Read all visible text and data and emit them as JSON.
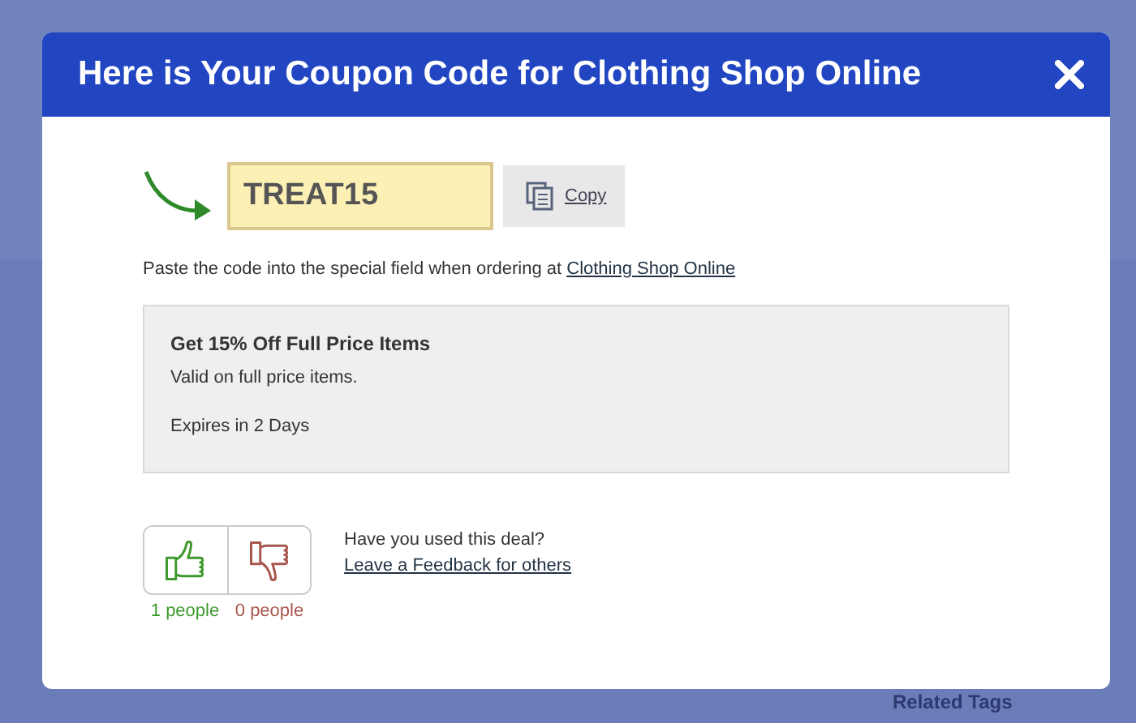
{
  "background": {
    "related_tags_heading": "Related Tags"
  },
  "dialog": {
    "title": "Here is Your Coupon Code for Clothing Shop Online",
    "code": {
      "value": "TREAT15"
    },
    "copy_button": {
      "label": "Copy"
    },
    "instruction": {
      "text": "Paste the code into the special field when ordering at",
      "link": "Clothing Shop Online"
    },
    "offer": {
      "title": "Get 15% Off Full Price Items",
      "description": "Valid on full price items.",
      "expires": "Expires in 2 Days"
    },
    "votes": [
      {
        "kind": "up",
        "count": "1 people"
      },
      {
        "kind": "down",
        "count": "0 people"
      }
    ],
    "feedback": {
      "question": "Have you used this deal?",
      "link": "Leave a Feedback for others"
    }
  }
}
